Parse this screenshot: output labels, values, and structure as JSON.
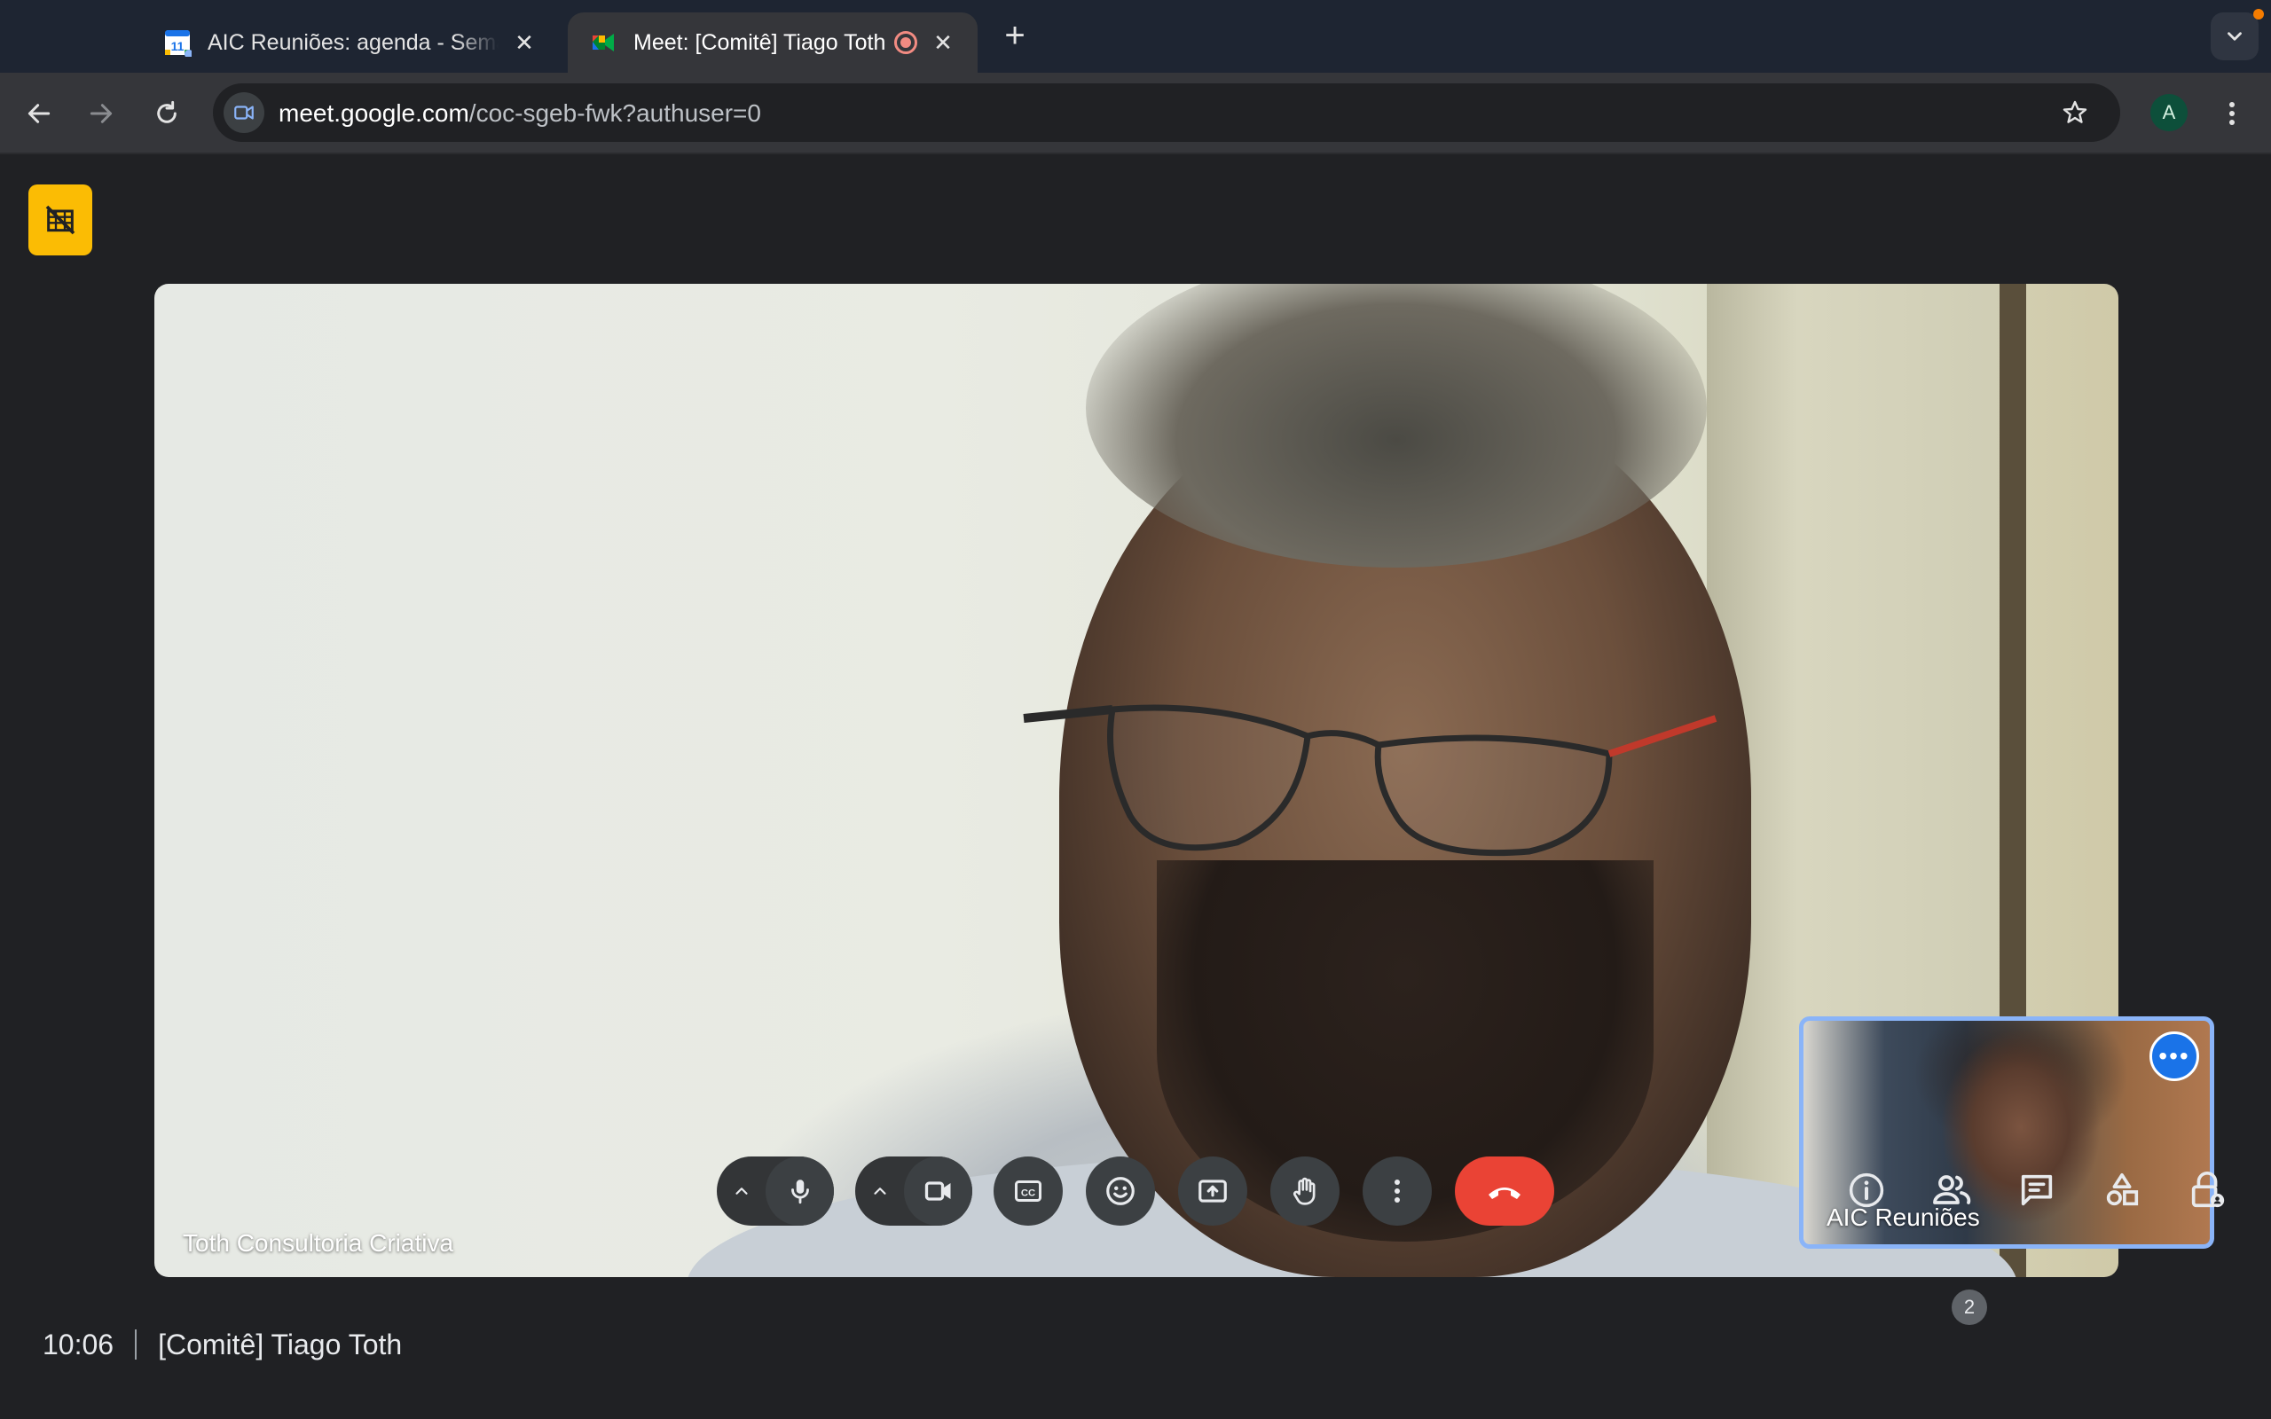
{
  "browser": {
    "tabs": [
      {
        "title": "AIC Reuniões: agenda - Semana",
        "favicon": "google-calendar-icon",
        "active": false
      },
      {
        "title": "Meet: [Comitê] Tiago Toth",
        "favicon": "google-meet-icon",
        "active": true,
        "recording": true
      }
    ],
    "url_host": "meet.google.com",
    "url_path": "/coc-sgeb-fwk?authuser=0",
    "profile_initial": "A",
    "calendar_day": "11"
  },
  "meet": {
    "main_participant": "Toth Consultoria Criativa",
    "self_participant": "AIC Reuniões",
    "time": "10:06",
    "meeting_title": "[Comitê] Tiago Toth",
    "people_count": "2",
    "self_more_label": "•••"
  },
  "colors": {
    "end_call": "#ea4335",
    "self_tile_border": "#8ab4f8",
    "badge": "#fbbc04",
    "recording": "#f28b82"
  }
}
